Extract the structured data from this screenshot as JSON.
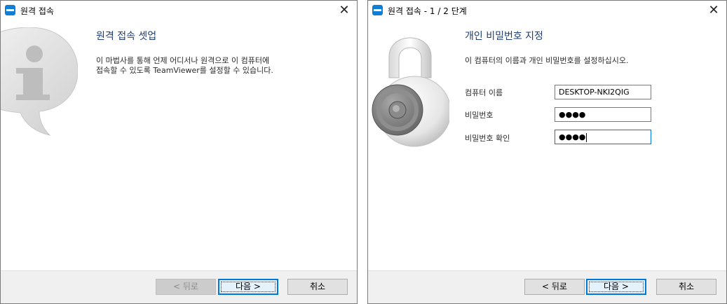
{
  "window1": {
    "title": "원격 접속",
    "close_glyph": "✕",
    "heading": "원격 접속 셋업",
    "description_line1": "이 마법사를 통해 언제 어디서나 원격으로 이 컴퓨터에",
    "description_line2": "접속할 수 있도록 TeamViewer를 설정할 수 있습니다.",
    "buttons": {
      "back": "< 뒤로",
      "next": "다음 >",
      "cancel": "취소"
    },
    "illustration_icon": "info-icon"
  },
  "window2": {
    "title": "원격 접속 - 1 / 2 단계",
    "close_glyph": "✕",
    "heading": "개인 비밀번호 지정",
    "description": "이 컴퓨터의 이름과 개인 비밀번호를 설정하십시오.",
    "fields": {
      "computer_name_label": "컴퓨터 이름",
      "computer_name_value": "DESKTOP-NKI2QIG",
      "password_label": "비밀번호",
      "password_value": "●●●●",
      "confirm_label": "비밀번호 확인",
      "confirm_value": "●●●●"
    },
    "buttons": {
      "back": "< 뒤로",
      "next": "다음 >",
      "cancel": "취소"
    },
    "illustration_icon": "padlock-icon"
  },
  "colors": {
    "heading": "#1e3e74",
    "accent": "#0078d7",
    "app_icon": "#0e7fd4",
    "footer": "#f0f0f0"
  }
}
